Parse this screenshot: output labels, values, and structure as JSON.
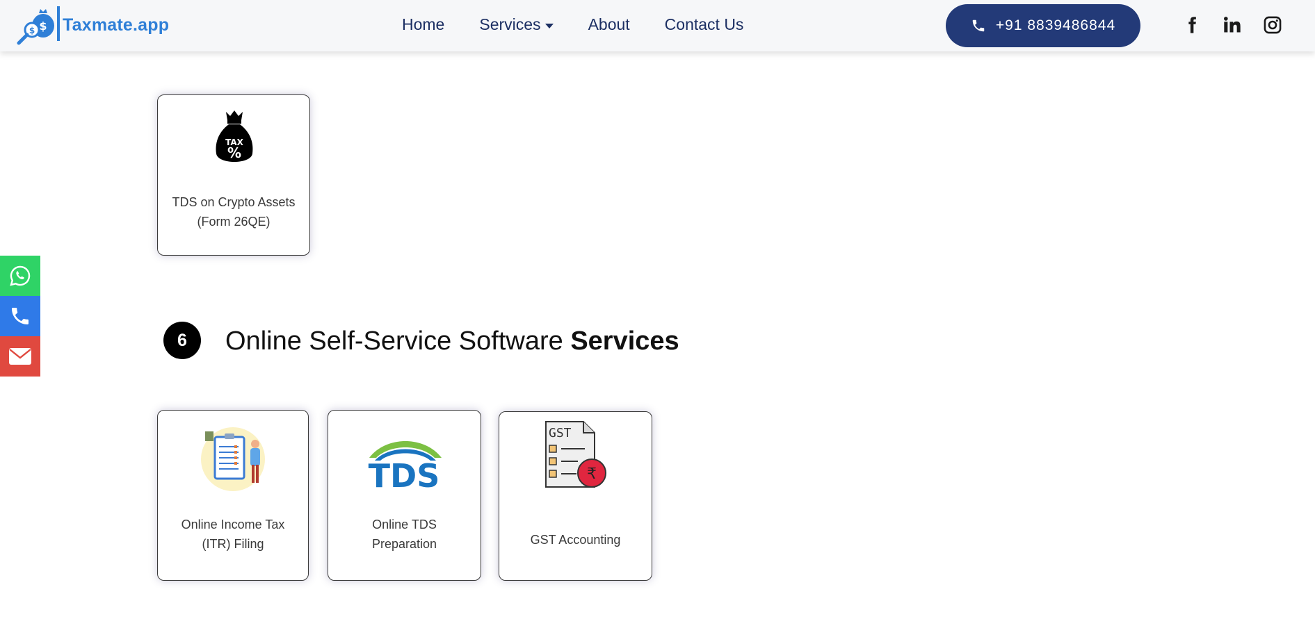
{
  "header": {
    "logo_text": "Taxmate.app",
    "nav": [
      {
        "label": "Home"
      },
      {
        "label": "Services"
      },
      {
        "label": "About"
      },
      {
        "label": "Contact Us"
      }
    ],
    "phone": "+91 8839486844",
    "social": [
      "facebook-icon",
      "linkedin-icon",
      "instagram-icon"
    ]
  },
  "side_contacts": [
    "whatsapp-icon",
    "phone-icon",
    "mail-icon"
  ],
  "crypto_card": {
    "icon_text_top": "TAX",
    "icon_text_bottom": "%",
    "label_line1": "TDS on Crypto Assets",
    "label_line2": "(Form 26QE)"
  },
  "section": {
    "number": "6",
    "title_regular": "Online Self-Service Software ",
    "title_bold": "Services"
  },
  "cards": [
    {
      "label_line1": "Online Income Tax",
      "label_line2": "(ITR) Filing"
    },
    {
      "label_line1": "Online TDS",
      "label_line2": "Preparation",
      "logo_text": "TDS"
    },
    {
      "label_line1": "GST Accounting",
      "label_line2": "",
      "doc_text": "GST",
      "seal_text": "₹"
    }
  ],
  "colors": {
    "brand_blue": "#2f7fd7",
    "nav_navy": "#1c2f63",
    "phone_btn": "#233a78",
    "whatsapp": "#2fd366",
    "phone": "#2f7ae8",
    "mail": "#e0493f",
    "tds_blue": "#1a74c0",
    "tds_green": "#7cc043",
    "gst_seal": "#e0263f"
  }
}
